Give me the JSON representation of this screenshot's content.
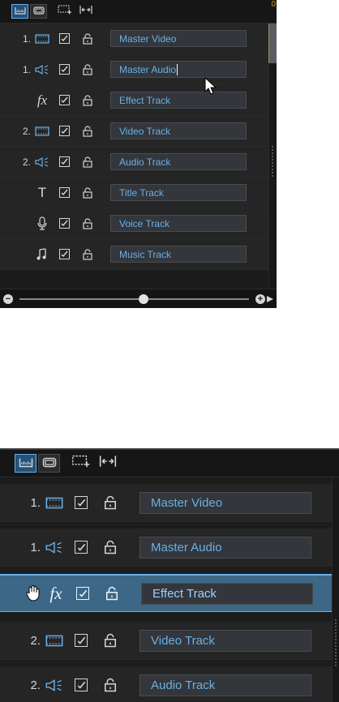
{
  "top_panel": {
    "toolbar": {
      "timeline_view_icon": "timeline-view-icon",
      "storyboard_view_icon": "storyboard-view-icon",
      "add_track_icon": "add-track-icon",
      "fit_icon": "fit-icon",
      "ruler_tag": "0"
    },
    "tracks": [
      {
        "number": "1.",
        "type_icon": "video-track-icon",
        "name": "Master Video",
        "checked": true
      },
      {
        "number": "1.",
        "type_icon": "audio-track-icon",
        "name": "Master Audio",
        "checked": true,
        "editing": true
      },
      {
        "number": "",
        "type_icon": "fx-icon",
        "type_label": "fx",
        "name": "Effect Track",
        "checked": true
      },
      {
        "number": "2.",
        "type_icon": "video-track-icon",
        "name": "Video Track",
        "checked": true
      },
      {
        "number": "2.",
        "type_icon": "audio-track-icon",
        "name": "Audio Track",
        "checked": true
      },
      {
        "number": "",
        "type_icon": "title-icon",
        "type_label": "T",
        "name": "Title Track",
        "checked": true
      },
      {
        "number": "",
        "type_icon": "microphone-icon",
        "name": "Voice Track",
        "checked": true
      },
      {
        "number": "",
        "type_icon": "music-icon",
        "name": "Music Track",
        "checked": true
      }
    ],
    "zoom": {
      "minus": "−",
      "plus": "+",
      "level": 0.54
    }
  },
  "bottom_panel": {
    "toolbar": {
      "timeline_view_icon": "timeline-view-icon",
      "storyboard_view_icon": "storyboard-view-icon",
      "add_track_icon": "add-track-icon",
      "fit_icon": "fit-icon"
    },
    "tracks": [
      {
        "number": "1.",
        "type_icon": "video-track-icon",
        "name": "Master Video",
        "checked": true
      },
      {
        "number": "1.",
        "type_icon": "audio-track-icon",
        "name": "Master Audio",
        "checked": true
      },
      {
        "number": "",
        "type_icon": "fx-icon",
        "type_label": "fx",
        "name": "Effect Track",
        "checked": true,
        "selected": true
      },
      {
        "number": "2.",
        "type_icon": "video-track-icon",
        "name": "Video Track",
        "checked": true
      },
      {
        "number": "2.",
        "type_icon": "audio-track-icon",
        "name": "Audio Track",
        "checked": true
      }
    ]
  },
  "colors": {
    "panel_bg": "#1c1c1c",
    "row_bg": "#252525",
    "accent_blue": "#6ab0e6",
    "selected_row": "#3c6786",
    "ruler_tag": "#d8a100"
  }
}
